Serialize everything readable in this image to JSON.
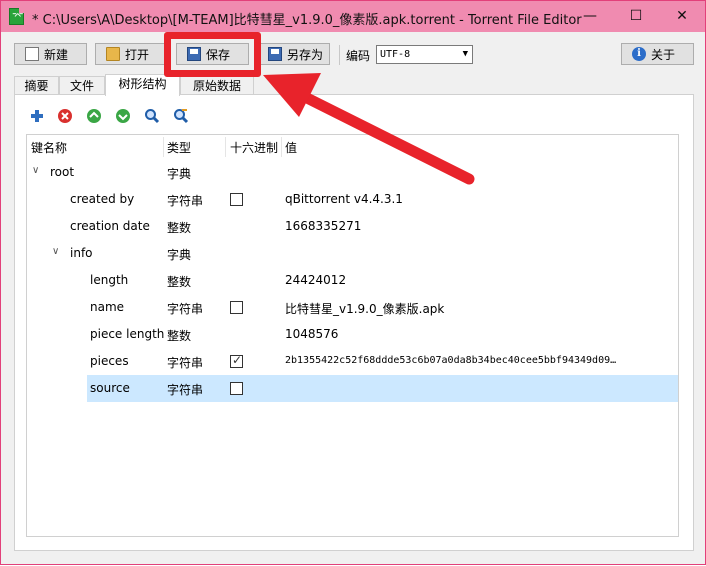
{
  "window": {
    "title": "* C:\\Users\\A\\Desktop\\[M-TEAM]比特彗星_v1.9.0_像素版.apk.torrent - Torrent File Editor",
    "app_icon": "torrent-editor-icon",
    "controls": {
      "minimize": "—",
      "maximize": "☐",
      "close": "✕"
    }
  },
  "toolbar": {
    "new_label": "新建",
    "open_label": "打开",
    "save_label": "保存",
    "save_as_label": "另存为",
    "encoding_label": "编码",
    "encoding_value": "UTF-8",
    "about_label": "关于"
  },
  "tabs": [
    "摘要",
    "文件",
    "树形结构",
    "原始数据"
  ],
  "active_tab": "树形结构",
  "tree_tools": [
    "add-icon",
    "remove-icon",
    "move-up-icon",
    "move-down-icon",
    "search-icon",
    "search-replace-icon"
  ],
  "tree": {
    "columns": [
      "键名称",
      "类型",
      "十六进制",
      "值"
    ],
    "rows": [
      {
        "name": "root",
        "type": "字典",
        "hex": "",
        "value": ""
      },
      {
        "name": "created by",
        "type": "字符串",
        "hex": "unchecked",
        "value": "qBittorrent v4.4.3.1"
      },
      {
        "name": "creation date",
        "type": "整数",
        "hex": "",
        "value": "1668335271"
      },
      {
        "name": "info",
        "type": "字典",
        "hex": "",
        "value": ""
      },
      {
        "name": "length",
        "type": "整数",
        "hex": "",
        "value": "24424012"
      },
      {
        "name": "name",
        "type": "字符串",
        "hex": "unchecked",
        "value": "比特彗星_v1.9.0_像素版.apk"
      },
      {
        "name": "piece length",
        "type": "整数",
        "hex": "",
        "value": "1048576"
      },
      {
        "name": "pieces",
        "type": "字符串",
        "hex": "checked",
        "value": "2b1355422c52f68ddde53c6b07a0da8b34bec40cee5bbf94349d09…"
      },
      {
        "name": "source",
        "type": "字符串",
        "hex": "unchecked",
        "value": ""
      }
    ]
  },
  "colors": {
    "titlebar": "#f08bb0",
    "annotation": "#e8232b",
    "selection": "#cce8ff"
  }
}
